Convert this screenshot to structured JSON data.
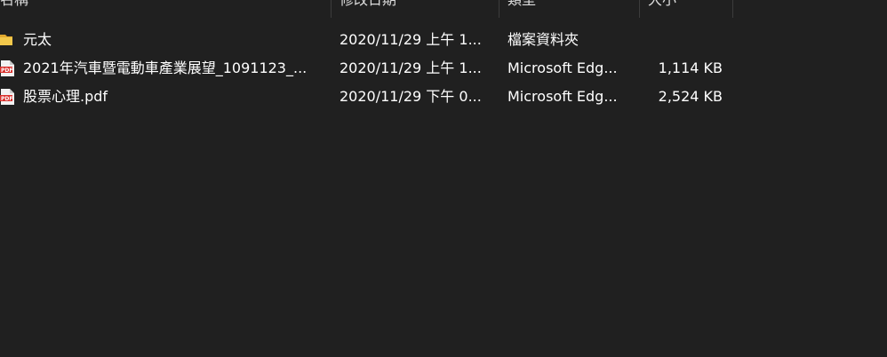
{
  "columns": {
    "name": "名稱",
    "modified": "修改日期",
    "type": "類型",
    "size": "大小"
  },
  "files": [
    {
      "icon": "folder-icon",
      "name": "元太",
      "modified": "2020/11/29 上午 1...",
      "type": "檔案資料夾",
      "size": ""
    },
    {
      "icon": "pdf-file-icon",
      "name": "2021年汽車暨電動車產業展望_1091123_...",
      "modified": "2020/11/29 上午 1...",
      "type": "Microsoft Edg...",
      "size": "1,114 KB"
    },
    {
      "icon": "pdf-file-icon",
      "name": "股票心理.pdf",
      "modified": "2020/11/29 下午 0...",
      "type": "Microsoft Edg...",
      "size": "2,524 KB"
    }
  ],
  "colors": {
    "background": "#202020",
    "text": "#ffffff",
    "divider": "#3c3c3c",
    "folder": "#f2c84b",
    "pdf": "#d9302c"
  }
}
